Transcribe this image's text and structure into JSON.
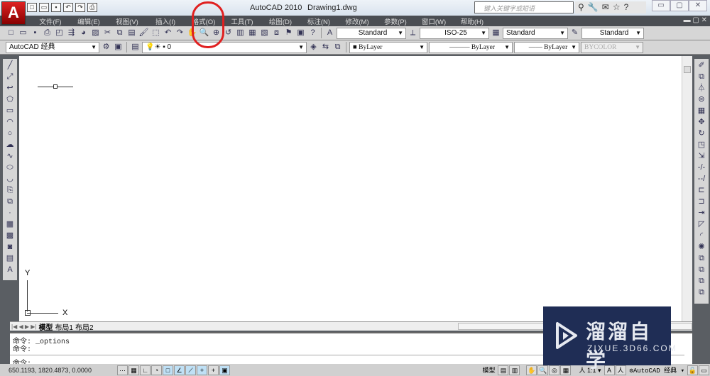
{
  "title": {
    "app": "AutoCAD 2010",
    "document": "Drawing1.dwg",
    "app_button": "A"
  },
  "search": {
    "placeholder": "键入关键字或短语"
  },
  "menu": [
    "文件(F)",
    "编辑(E)",
    "视图(V)",
    "插入(I)",
    "格式(O)",
    "工具(T)",
    "绘图(D)",
    "标注(N)",
    "修改(M)",
    "参数(P)",
    "窗口(W)",
    "帮助(H)"
  ],
  "toolbar1": {
    "text_style": "Standard",
    "dim_style": "ISO-25",
    "table_style": "Standard",
    "mleader_style": "Standard"
  },
  "toolbar2": {
    "workspace": "AutoCAD 经典",
    "layer": "0",
    "color": "ByLayer",
    "linetype": "ByLayer",
    "lineweight": "ByLayer",
    "plotstyle": "BYCOLOR"
  },
  "ucs": {
    "x": "X",
    "y": "Y"
  },
  "tabs": [
    "模型",
    "布局1",
    "布局2"
  ],
  "command": {
    "history": [
      "命令: _options",
      "命令:"
    ],
    "prompt": "命令:"
  },
  "status": {
    "coords": "650.1193,  1820.4873, 0.0000",
    "model": "模型",
    "scale": "1:1",
    "workspace": "AutoCAD 经典"
  },
  "watermark": {
    "name": "溜溜自学",
    "url": "ZIXUE.3D66.COM"
  },
  "colors": {
    "menubar": "#4b4e53",
    "toolbar": "#d6d6d6",
    "watermark": "#1f2d55"
  }
}
